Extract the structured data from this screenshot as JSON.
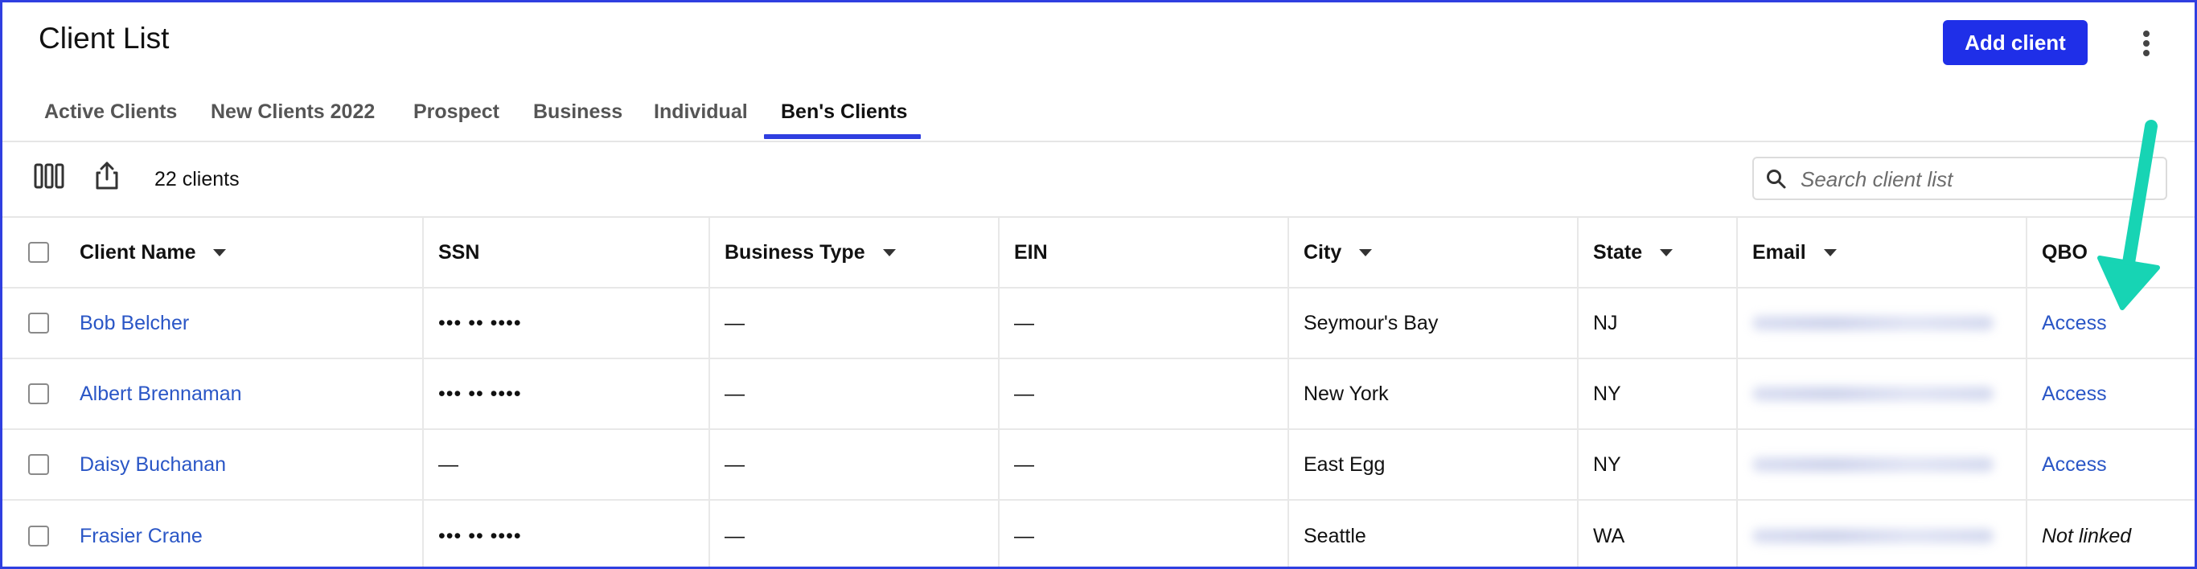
{
  "header": {
    "title": "Client List",
    "add_client_label": "Add client"
  },
  "tabs": [
    {
      "label": "Active Clients"
    },
    {
      "label": "New Clients 2022"
    },
    {
      "label": "Prospect"
    },
    {
      "label": "Business"
    },
    {
      "label": "Individual"
    },
    {
      "label": "Ben's Clients",
      "active": true
    }
  ],
  "toolbar": {
    "count_label": "22 clients",
    "search_placeholder": "Search client list",
    "icons": [
      "columns-icon",
      "share-icon",
      "search-icon"
    ]
  },
  "table": {
    "columns": [
      "Client Name",
      "SSN",
      "Business Type",
      "EIN",
      "City",
      "State",
      "Email",
      "QBO"
    ],
    "rows": [
      {
        "name": "Bob Belcher",
        "ssn": "••• •• ••••",
        "business_type": "—",
        "ein": "—",
        "city": "Seymour's Bay",
        "state": "NJ",
        "qbo": "Access"
      },
      {
        "name": "Albert Brennaman",
        "ssn": "••• •• ••••",
        "business_type": "—",
        "ein": "—",
        "city": "New York",
        "state": "NY",
        "qbo": "Access"
      },
      {
        "name": "Daisy Buchanan",
        "ssn": "—",
        "business_type": "—",
        "ein": "—",
        "city": "East Egg",
        "state": "NY",
        "qbo": "Access"
      },
      {
        "name": "Frasier Crane",
        "ssn": "••• •• ••••",
        "business_type": "—",
        "ein": "—",
        "city": "Seattle",
        "state": "WA",
        "qbo": "Not linked"
      }
    ]
  },
  "colors": {
    "accent": "#1f2fe8",
    "link": "#2a56c6",
    "annotation_arrow": "#17d4b4"
  }
}
